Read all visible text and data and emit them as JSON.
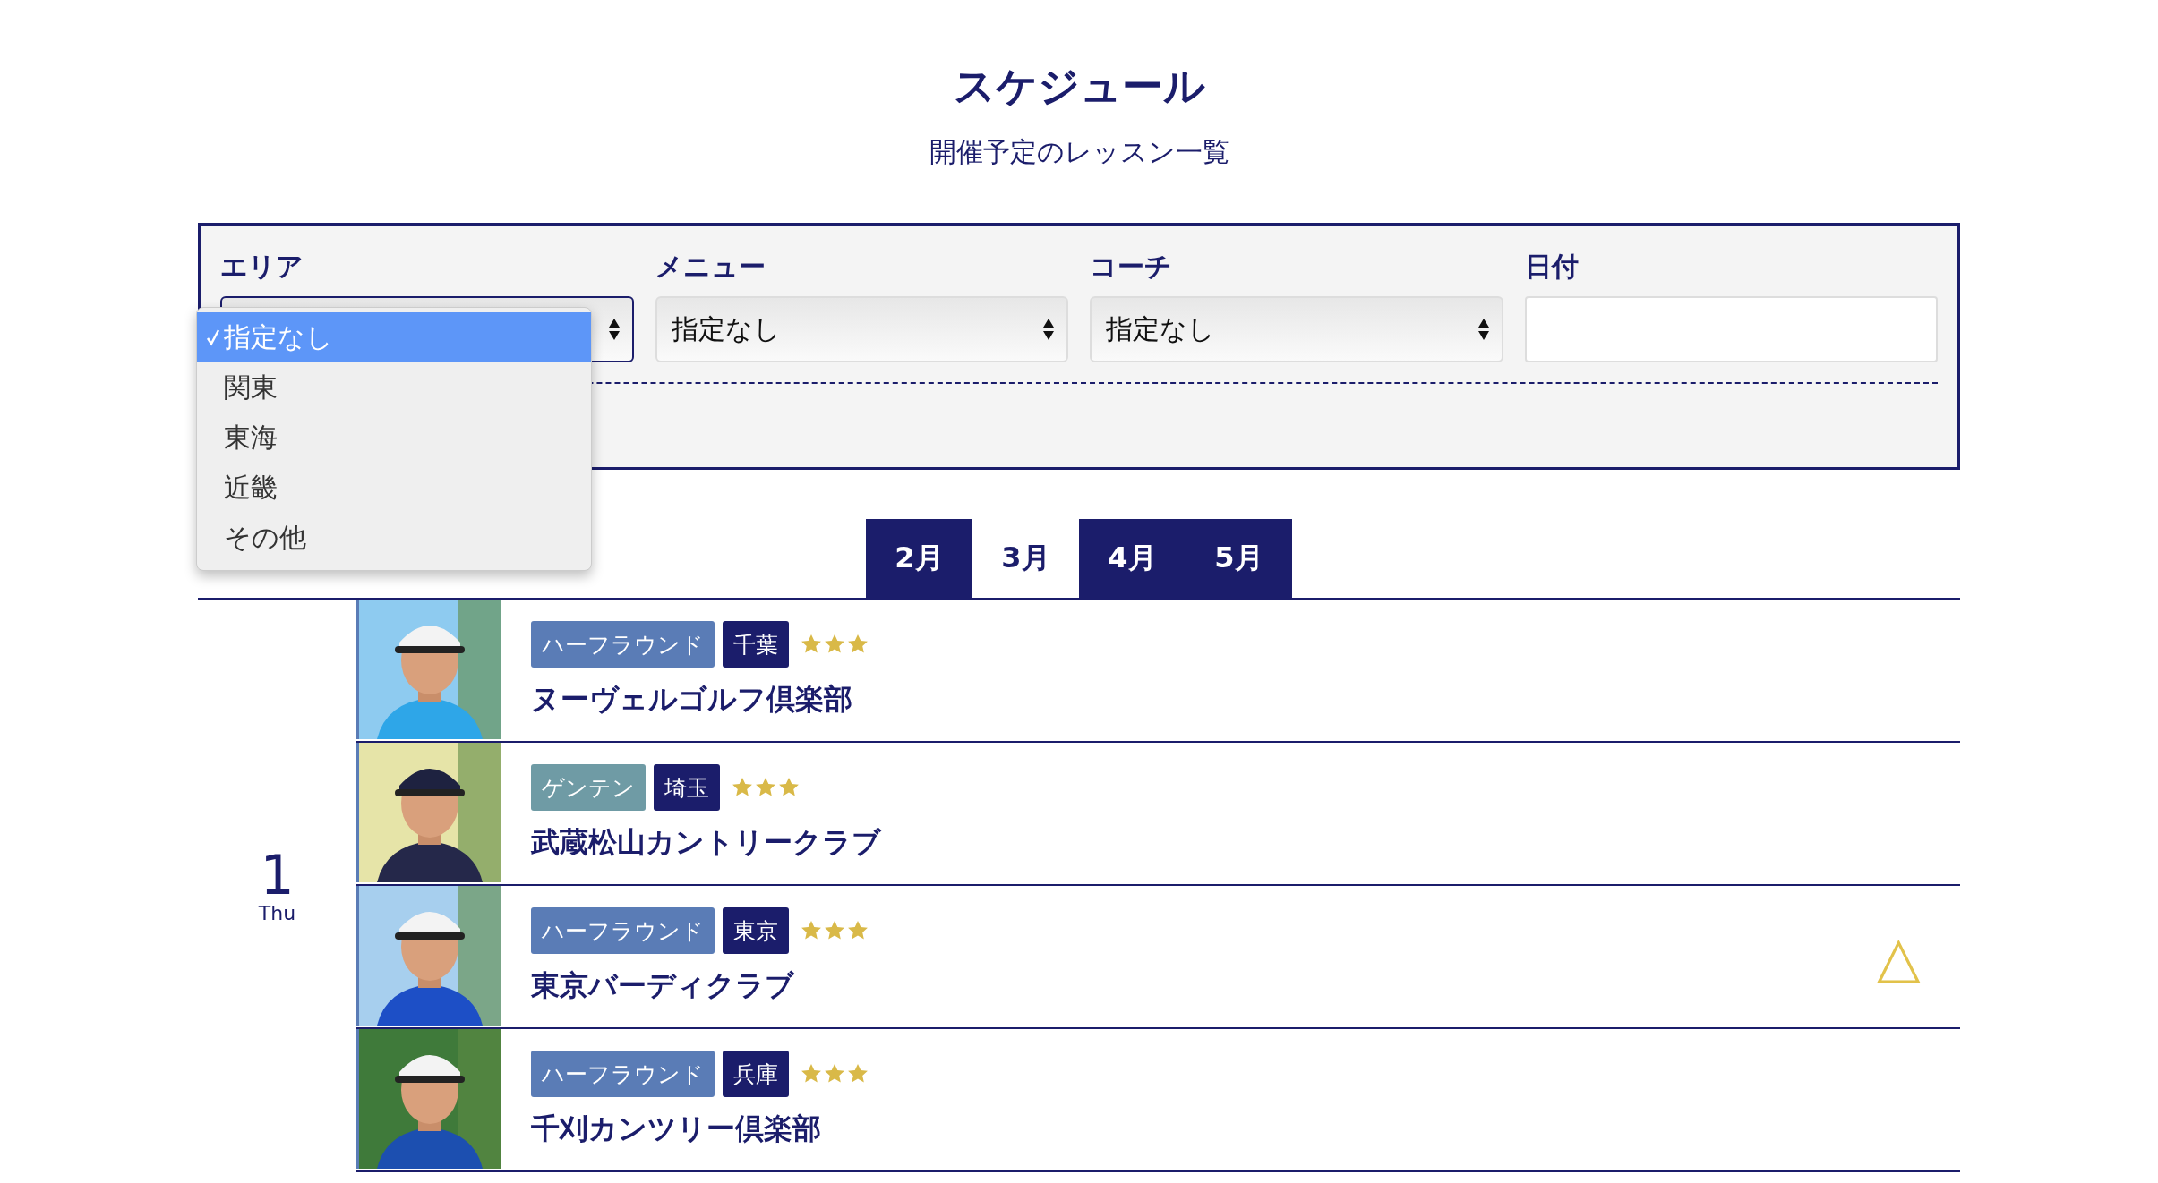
{
  "header": {
    "title": "スケジュール",
    "subtitle": "開催予定のレッスン一覧"
  },
  "filters": [
    {
      "label": "エリア",
      "kind": "select",
      "focused": true
    },
    {
      "label": "メニュー",
      "kind": "select",
      "focused": false,
      "value": "指定なし"
    },
    {
      "label": "コーチ",
      "kind": "select",
      "focused": false,
      "value": "指定なし"
    },
    {
      "label": "日付",
      "kind": "date"
    }
  ],
  "area_dropdown": {
    "options": [
      {
        "label": "指定なし",
        "selected": true
      },
      {
        "label": "関東",
        "selected": false
      },
      {
        "label": "東海",
        "selected": false
      },
      {
        "label": "近畿",
        "selected": false
      },
      {
        "label": "その他",
        "selected": false
      }
    ]
  },
  "month_tabs": [
    {
      "label": "2月",
      "selected": false
    },
    {
      "label": "3月",
      "selected": true
    },
    {
      "label": "4月",
      "selected": false
    },
    {
      "label": "5月",
      "selected": false
    }
  ],
  "days": [
    {
      "day": "1",
      "weekday": "Thu",
      "lessons": [
        {
          "menu": "ハーフラウンド",
          "color": "#5a7cb6",
          "area": "千葉",
          "stars": 3,
          "course": "ヌーヴェルゴルフ倶楽部"
        },
        {
          "menu": "ゲンテン",
          "color": "#6f9ba5",
          "area": "埼玉",
          "stars": 3,
          "course": "武蔵松山カントリークラブ"
        },
        {
          "menu": "ハーフラウンド",
          "color": "#5a7cb6",
          "area": "東京",
          "stars": 3,
          "course": "東京バーディクラブ",
          "status": "△"
        },
        {
          "menu": "ハーフラウンド",
          "color": "#5a7cb6",
          "area": "兵庫",
          "stars": 3,
          "course": "千刈カンツリー倶楽部"
        }
      ]
    }
  ]
}
